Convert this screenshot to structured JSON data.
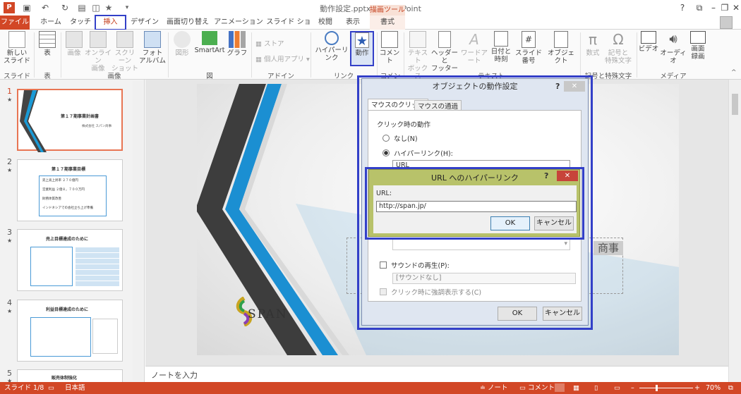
{
  "app": {
    "title": "動作設定.pptx - PowerPoint",
    "context_header": "描画ツール"
  },
  "tabs": [
    "ファイル",
    "ホーム",
    "タッチ",
    "挿入",
    "デザイン",
    "画面切り替え",
    "アニメーション",
    "スライド ショー",
    "校閲",
    "表示",
    "書式"
  ],
  "ribbon": {
    "slides": {
      "new_slide": "新しい\nスライド",
      "group": "スライド"
    },
    "table": {
      "table": "表",
      "group": "表"
    },
    "images": {
      "picture": "画像",
      "online": "オンライン\n画像",
      "screenshot": "スクリーン\nショット",
      "album": "フォト\nアルバム",
      "group": "画像"
    },
    "illustrations": {
      "shapes": "図形",
      "smartart": "SmartArt",
      "chart": "グラフ",
      "group": "図"
    },
    "addins": {
      "store": "ストア",
      "personal": "個人用アプリ",
      "group": "アドイン"
    },
    "links": {
      "hyperlink": "ハイパーリンク",
      "action": "動作",
      "group": "リンク"
    },
    "comments": {
      "comment": "コメント",
      "group": "コメント"
    },
    "text": {
      "textbox": "テキスト\nボックス",
      "header": "ヘッダーと\nフッター",
      "wordart": "ワードアート",
      "datetime": "日付と\n時刻",
      "slidenum": "スライド番号",
      "object": "オブジェクト",
      "group": "テキスト"
    },
    "symbols": {
      "equation": "数式",
      "symbol": "記号と\n特殊文字",
      "group": "記号と特殊文字"
    },
    "media": {
      "video": "ビデオ",
      "audio": "オーディオ",
      "screenrec": "画面\n録画",
      "group": "メディア"
    }
  },
  "thumbnails": [
    {
      "num": "1",
      "title": "第１７期事業計画書",
      "sub": "株式会社 スパン商事"
    },
    {
      "num": "2",
      "title": "第１７期事業目標",
      "lines": [
        "売上高上昇率 ２７０億円",
        "営業利益 ２億８，７００万円",
        "財務体質改善",
        "インドネシアでの会社立ち上げ準備"
      ]
    },
    {
      "num": "3",
      "title": "売上目標達成のために"
    },
    {
      "num": "4",
      "title": "利益目標達成のために"
    },
    {
      "num": "5",
      "title": "販売体制強化"
    }
  ],
  "slide": {
    "logo_text": "SPAN",
    "company": "商事"
  },
  "notes": {
    "placeholder": "ノートを入力"
  },
  "status": {
    "slide": "スライド 1/8",
    "lang": "日本語",
    "notes": "ノート",
    "comments": "コメント",
    "zoom": "70%"
  },
  "dialog_action": {
    "title": "オブジェクトの動作設定",
    "help": "?",
    "tab_click": "マウスのクリック",
    "tab_over": "マウスの通過",
    "section": "クリック時の動作",
    "opt_none": "なし(N)",
    "opt_hyperlink": "ハイパーリンク(H):",
    "hyperlink_value": "URL",
    "sound_label": "サウンドの再生(P):",
    "sound_value": "[サウンドなし]",
    "highlight_label": "クリック時に強調表示する(C)",
    "ok": "OK",
    "cancel": "キャンセル"
  },
  "dialog_url": {
    "title": "URL へのハイパーリンク",
    "help": "?",
    "label": "URL:",
    "value": "http://span.jp/",
    "ok": "OK",
    "cancel": "キャンセル"
  },
  "colors": {
    "accent": "#d24726",
    "highlight": "#3340c8",
    "dialog_green": "#b8c26a"
  }
}
